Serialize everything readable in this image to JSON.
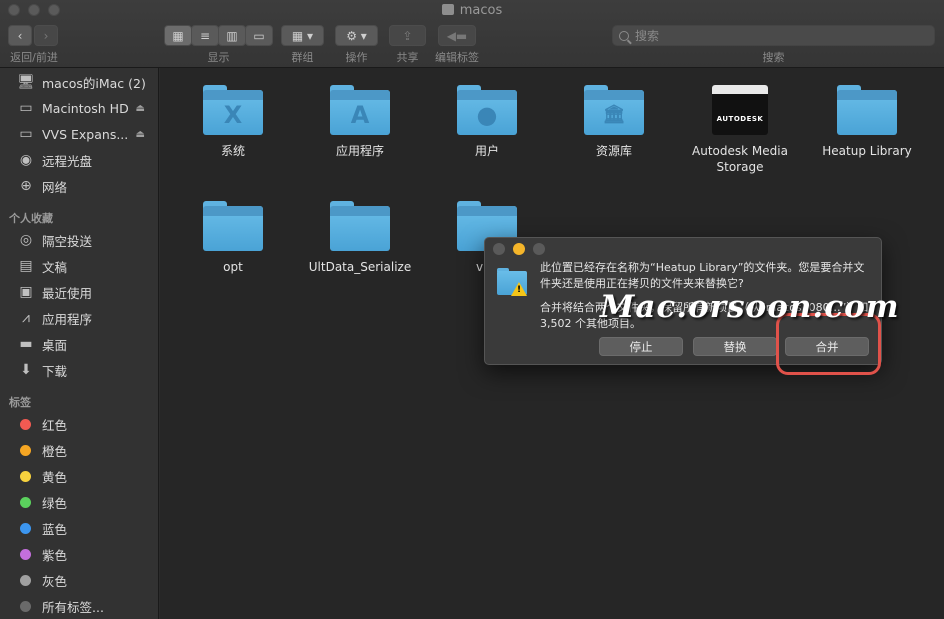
{
  "window": {
    "title": "macos"
  },
  "toolbar": {
    "back_label": "返回/前进",
    "view_label": "显示",
    "group_label": "群组",
    "action_label": "操作",
    "share_label": "共享",
    "tags_label": "编辑标签",
    "search_label": "搜索",
    "search_placeholder": "搜索"
  },
  "sidebar": {
    "devices": [
      {
        "label": "macos的iMac (2)",
        "icon": "imac-icon"
      },
      {
        "label": "Macintosh HD",
        "icon": "harddisk-icon",
        "eject": "⏏"
      },
      {
        "label": "VVS Expans...",
        "icon": "harddisk-icon",
        "eject": "⏏"
      },
      {
        "label": "远程光盘",
        "icon": "disc-icon"
      },
      {
        "label": "网络",
        "icon": "globe-icon"
      }
    ],
    "favorites_title": "个人收藏",
    "favorites": [
      {
        "label": "隔空投送",
        "icon": "airdrop-icon"
      },
      {
        "label": "文稿",
        "icon": "document-icon"
      },
      {
        "label": "最近使用",
        "icon": "recents-icon"
      },
      {
        "label": "应用程序",
        "icon": "applications-icon"
      },
      {
        "label": "桌面",
        "icon": "desktop-icon"
      },
      {
        "label": "下载",
        "icon": "download-icon"
      }
    ],
    "tags_title": "标签",
    "tags": [
      {
        "label": "红色",
        "color": "#f15a52"
      },
      {
        "label": "橙色",
        "color": "#f5a623"
      },
      {
        "label": "黄色",
        "color": "#f7d23e"
      },
      {
        "label": "绿色",
        "color": "#5bd15d"
      },
      {
        "label": "蓝色",
        "color": "#3c96f0"
      },
      {
        "label": "紫色",
        "color": "#c46fdc"
      },
      {
        "label": "灰色",
        "color": "#a0a0a0"
      },
      {
        "label": "所有标签...",
        "color": "#6a6a6a"
      }
    ]
  },
  "files": [
    {
      "name": "系统",
      "icon": "system-folder-icon",
      "glyph": "X"
    },
    {
      "name": "应用程序",
      "icon": "applications-folder-icon",
      "glyph": "A"
    },
    {
      "name": "用户",
      "icon": "users-folder-icon",
      "glyph": "●"
    },
    {
      "name": "资源库",
      "icon": "library-folder-icon",
      "glyph": "🏛"
    },
    {
      "name": "Autodesk Media Storage",
      "icon": "autodesk-icon",
      "glyph": "AUTODESK"
    },
    {
      "name": "Heatup Library",
      "icon": "folder-icon",
      "glyph": ""
    },
    {
      "name": "opt",
      "icon": "folder-icon",
      "glyph": ""
    },
    {
      "name": "UltData_Serialize",
      "icon": "folder-icon",
      "glyph": ""
    },
    {
      "name": "v",
      "icon": "folder-icon",
      "glyph": ""
    }
  ],
  "dialog": {
    "message": "此位置已经存在名称为“Heatup Library”的文件夹。您是要合并文件夹还是使用正在拷贝的文件夹来替换它?",
    "detail": "合并将结合两个文件夹，保留所有新项目（从“macos1080…”）和3,502 个其他项目。",
    "stop_label": "停止",
    "replace_label": "替换",
    "merge_label": "合并"
  },
  "watermark": "Mac.orsoon.com"
}
